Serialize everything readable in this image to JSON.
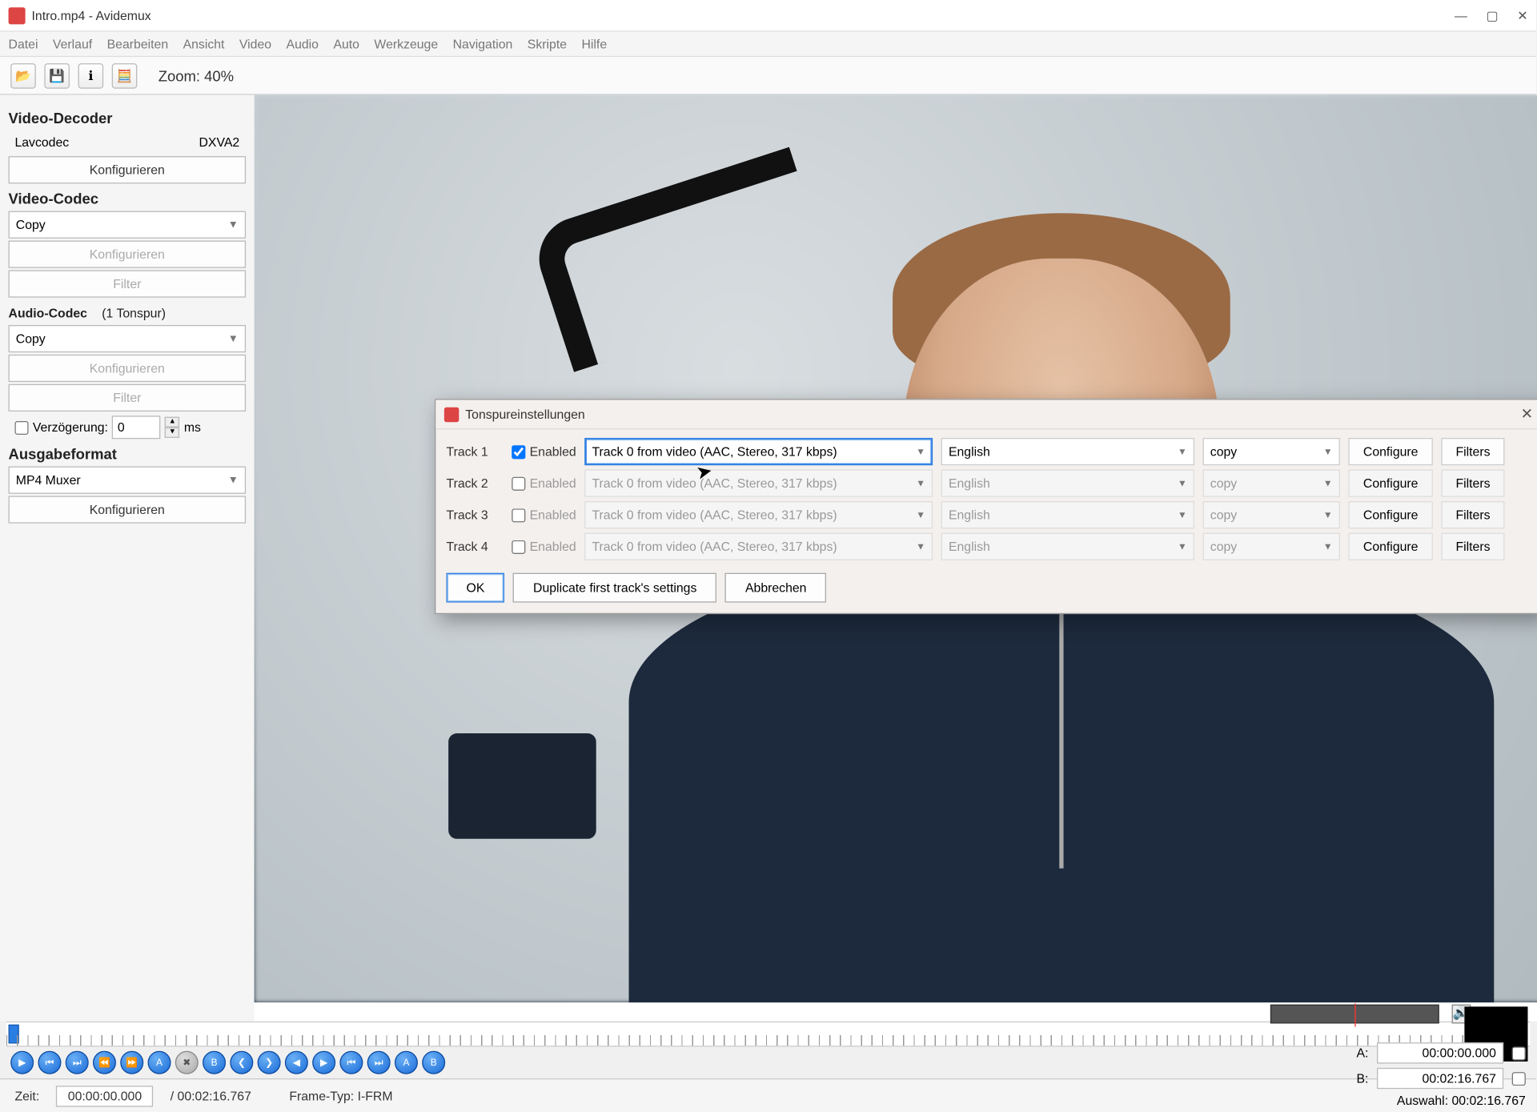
{
  "window": {
    "title": "Intro.mp4 - Avidemux",
    "minimize": "—",
    "maximize": "▢",
    "close": "✕"
  },
  "menu": {
    "items": [
      "Datei",
      "Verlauf",
      "Bearbeiten",
      "Ansicht",
      "Video",
      "Audio",
      "Auto",
      "Werkzeuge",
      "Navigation",
      "Skripte",
      "Hilfe"
    ]
  },
  "toolbar": {
    "zoom": "Zoom: 40%"
  },
  "sidebar": {
    "video_decoder": {
      "title": "Video-Decoder",
      "left": "Lavcodec",
      "right": "DXVA2",
      "configure": "Konfigurieren"
    },
    "video_codec": {
      "title": "Video-Codec",
      "select": "Copy",
      "configure": "Konfigurieren",
      "filter": "Filter"
    },
    "audio_codec": {
      "title": "Audio-Codec",
      "count": "(1 Tonspur)",
      "select": "Copy",
      "configure": "Konfigurieren",
      "filter": "Filter",
      "delay_label": "Verzögerung:",
      "delay_value": "0",
      "delay_unit": "ms"
    },
    "output": {
      "title": "Ausgabeformat",
      "select": "MP4 Muxer",
      "configure": "Konfigurieren"
    }
  },
  "transport": {
    "time_label": "Zeit:",
    "time_value": "00:00:00.000",
    "duration": "/ 00:02:16.767",
    "frame_label": "Frame-Typ: I-FRM"
  },
  "ab": {
    "A_label": "A:",
    "A_value": "00:00:00.000",
    "B_label": "B:",
    "B_value": "00:02:16.767",
    "sel_label": "Auswahl: 00:02:16.767"
  },
  "dialog": {
    "title": "Tonspureinstellungen",
    "tracks": [
      {
        "name": "Track 1",
        "enabled": true,
        "source": "Track 0 from video (AAC, Stereo, 317 kbps)",
        "lang": "English",
        "codec": "copy",
        "configure": "Configure",
        "filters": "Filters"
      },
      {
        "name": "Track 2",
        "enabled": false,
        "source": "Track 0 from video (AAC, Stereo, 317 kbps)",
        "lang": "English",
        "codec": "copy",
        "configure": "Configure",
        "filters": "Filters"
      },
      {
        "name": "Track 3",
        "enabled": false,
        "source": "Track 0 from video (AAC, Stereo, 317 kbps)",
        "lang": "English",
        "codec": "copy",
        "configure": "Configure",
        "filters": "Filters"
      },
      {
        "name": "Track 4",
        "enabled": false,
        "source": "Track 0 from video (AAC, Stereo, 317 kbps)",
        "lang": "English",
        "codec": "copy",
        "configure": "Configure",
        "filters": "Filters"
      }
    ],
    "enabled_label": "Enabled",
    "ok": "OK",
    "dup": "Duplicate first track's settings",
    "cancel": "Abbrechen"
  }
}
